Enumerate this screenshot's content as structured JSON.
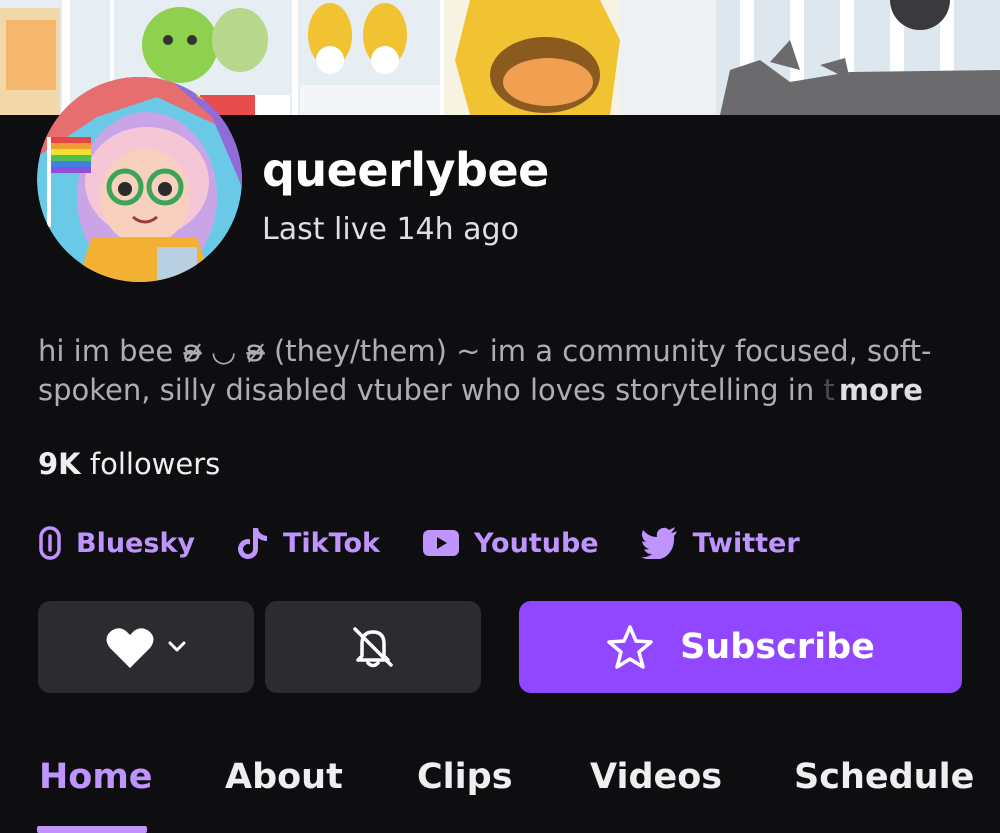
{
  "banner": {
    "image": "channel-banner"
  },
  "channel": {
    "name": "queerlybee",
    "last_live": "Last live 14h ago",
    "avatar": "avatar-image"
  },
  "bio": {
    "line1": "hi im bee ʚ̴̶̷̷ ◡ ʚ̴̶̷̷ (they/them) ~ im a community focused, soft-",
    "line2_main": "spoken, silly disabled vtuber who loves storytelling in",
    "line2_fade": " t",
    "more": "more"
  },
  "followers": {
    "count": "9K",
    "label": " followers"
  },
  "socials": [
    {
      "label": "Bluesky",
      "icon": "link-icon"
    },
    {
      "label": "TikTok",
      "icon": "tiktok-icon"
    },
    {
      "label": "Youtube",
      "icon": "youtube-icon"
    },
    {
      "label": "Twitter",
      "icon": "twitter-icon"
    }
  ],
  "actions": {
    "follow_icon": "heart-icon",
    "notify_icon": "bell-off-icon",
    "subscribe_label": "Subscribe"
  },
  "tabs": [
    {
      "label": "Home",
      "active": true
    },
    {
      "label": "About"
    },
    {
      "label": "Clips"
    },
    {
      "label": "Videos"
    },
    {
      "label": "Schedule"
    }
  ],
  "colors": {
    "accent": "#bf94ff",
    "button_primary": "#9147ff",
    "background": "#0e0e10",
    "button_secondary": "#2b2b30"
  }
}
